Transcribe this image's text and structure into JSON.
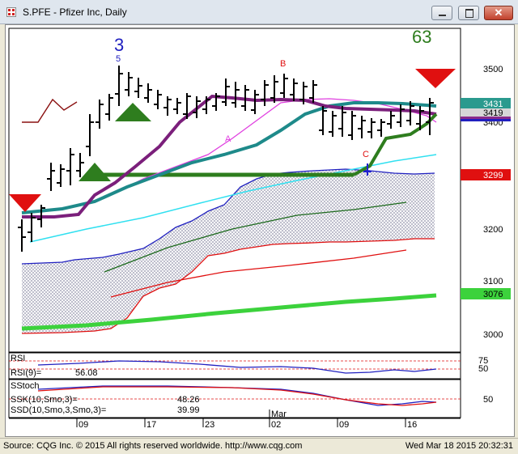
{
  "window": {
    "title": "S.PFE - Pfizer Inc, Daily",
    "buttons": {
      "close": "✕"
    }
  },
  "chart": {
    "counter_left": "3",
    "counter_left_small": "5",
    "counter_right": "63",
    "wave_labels": {
      "a": "A",
      "b": "B",
      "c": "C"
    },
    "price_axis_labels": [
      "3500",
      "3400",
      "3300",
      "3200",
      "3100",
      "3000"
    ],
    "price_tags": [
      {
        "label": "3431",
        "color": "#2a9a8e"
      },
      {
        "label": "3419",
        "color": "#8a2b8a"
      },
      {
        "label": "3299",
        "color": "#e01010"
      },
      {
        "label": "3076",
        "color": "#3cd23c"
      }
    ],
    "date_labels": [
      "09",
      "17",
      "23",
      "02",
      "09",
      "16"
    ],
    "month_label": "Mar",
    "rsi": {
      "header": "RSI",
      "label": "RSI(9)=",
      "value": "56.08",
      "levels": [
        "75",
        "50"
      ]
    },
    "sstoch": {
      "header": "SStoch",
      "ssk_label": "SSK(10,Smo,3)=",
      "ssk_value": "48.26",
      "ssd_label": "SSD(10,Smo,3,Smo,3)=",
      "ssd_value": "39.99",
      "level": "50"
    },
    "colors": {
      "bars": "#000000",
      "teal_ma": "#1e8a8a",
      "purple_ma": "#7b1f7b",
      "magenta_ma": "#e040e0",
      "cyan_line": "#30e0f0",
      "green_support": "#2e7d1e",
      "red_trend": "#e01010",
      "lime_band": "#3cd23c",
      "cloud_blue": "#2020c0",
      "indicator_red": "#e01010"
    }
  },
  "status": {
    "source": "Source: CQG Inc. © 2015 All rights reserved worldwide. http://www.cqg.com",
    "timestamp": "Wed Mar 18 2015 20:32:31"
  }
}
